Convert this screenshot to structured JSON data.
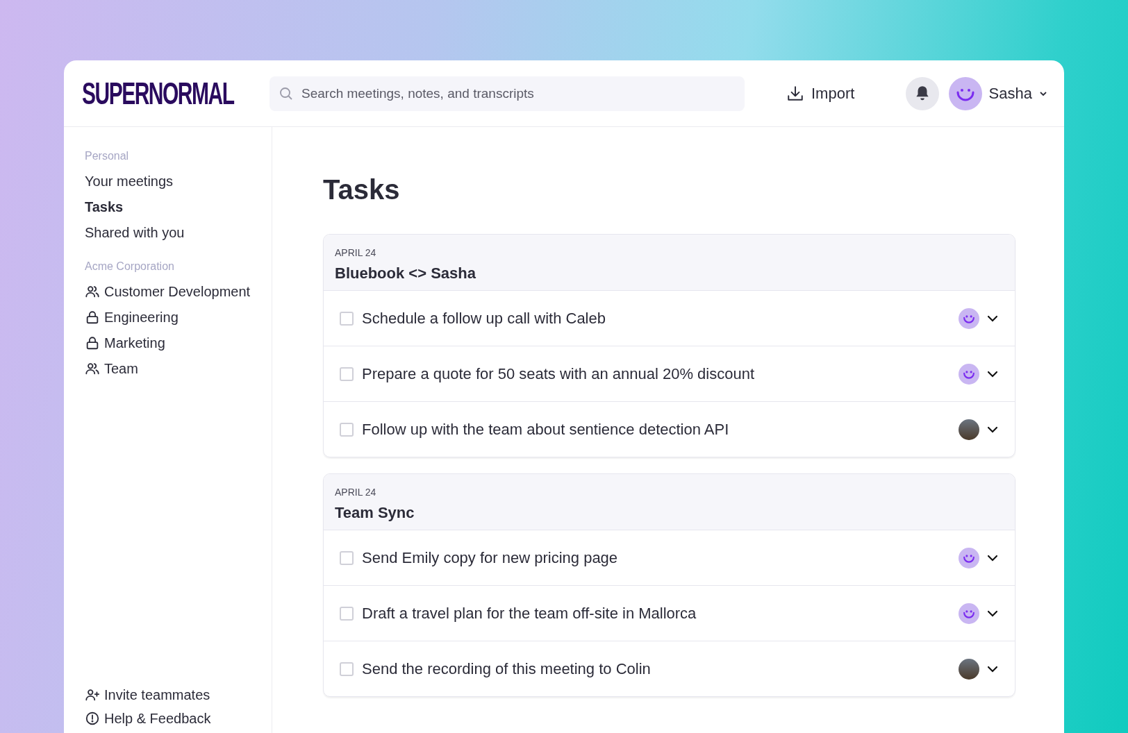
{
  "header": {
    "logo": "SUPERNORMAL",
    "search": {
      "placeholder": "Search meetings, notes, and transcripts"
    },
    "import_label": "Import",
    "user": {
      "name": "Sasha"
    }
  },
  "sidebar": {
    "sections": [
      {
        "heading": "Personal",
        "items": [
          {
            "label": "Your meetings",
            "selected": false
          },
          {
            "label": "Tasks",
            "selected": true
          },
          {
            "label": "Shared with you",
            "selected": false
          }
        ]
      },
      {
        "heading": "Acme Corporation",
        "items": [
          {
            "label": "Customer Development",
            "kind": "people",
            "selected": false
          },
          {
            "label": "Engineering",
            "kind": "lock",
            "selected": false
          },
          {
            "label": "Marketing",
            "kind": "lock",
            "selected": false
          },
          {
            "label": "Team",
            "kind": "people",
            "selected": false
          }
        ]
      }
    ],
    "footer": [
      {
        "label": "Invite teammates",
        "kind": "invite"
      },
      {
        "label": "Help & Feedback",
        "kind": "help"
      }
    ]
  },
  "page_title": "Tasks",
  "meetings": [
    {
      "date": "APRIL 24",
      "title": "Bluebook <> Sasha",
      "tasks": [
        {
          "text": "Schedule a follow up call with Caleb",
          "checked": false,
          "kind": "smiley"
        },
        {
          "text": "Prepare a quote for 50 seats with an annual 20% discount",
          "checked": false,
          "kind": "smiley"
        },
        {
          "text": "Follow up with the team about sentience detection API",
          "checked": false,
          "kind": "photo"
        }
      ]
    },
    {
      "date": "APRIL 24",
      "title": "Team Sync",
      "tasks": [
        {
          "text": "Send Emily copy for new pricing page",
          "checked": false,
          "kind": "smiley"
        },
        {
          "text": "Draft a travel plan for the team off-site in Mallorca",
          "checked": false,
          "kind": "smiley"
        },
        {
          "text": "Send the recording of this meeting to Colin",
          "checked": false,
          "kind": "photo"
        }
      ]
    }
  ]
}
